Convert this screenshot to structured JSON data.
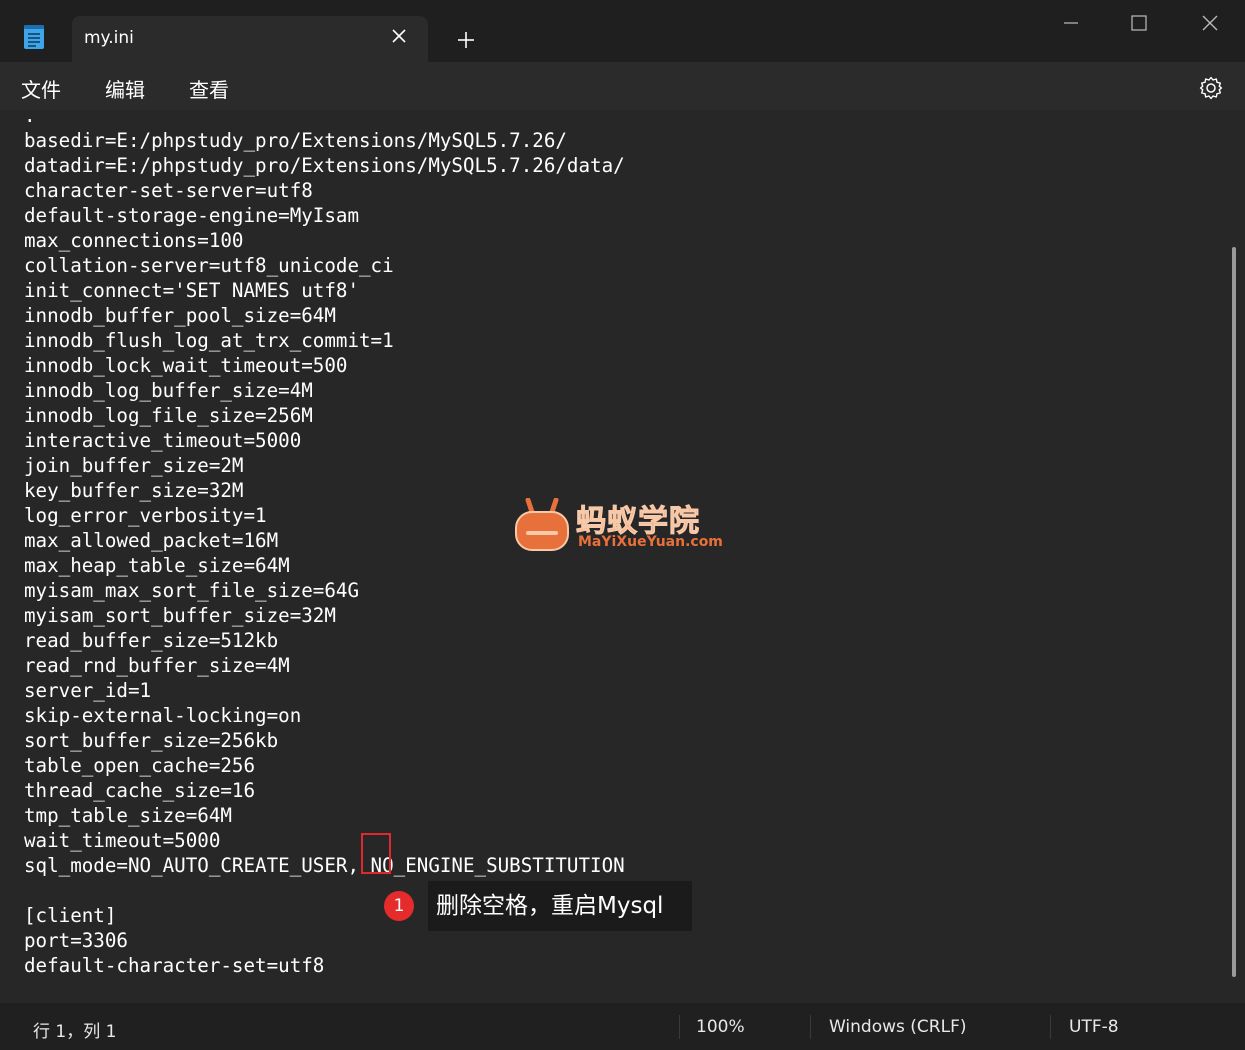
{
  "tab": {
    "title": "my.ini"
  },
  "menu": {
    "file": "文件",
    "edit": "编辑",
    "view": "查看"
  },
  "editor": {
    "lines": [
      ".",
      "basedir=E:/phpstudy_pro/Extensions/MySQL5.7.26/",
      "datadir=E:/phpstudy_pro/Extensions/MySQL5.7.26/data/",
      "character-set-server=utf8",
      "default-storage-engine=MyIsam",
      "max_connections=100",
      "collation-server=utf8_unicode_ci",
      "init_connect='SET NAMES utf8'",
      "innodb_buffer_pool_size=64M",
      "innodb_flush_log_at_trx_commit=1",
      "innodb_lock_wait_timeout=500",
      "innodb_log_buffer_size=4M",
      "innodb_log_file_size=256M",
      "interactive_timeout=5000",
      "join_buffer_size=2M",
      "key_buffer_size=32M",
      "log_error_verbosity=1",
      "max_allowed_packet=16M",
      "max_heap_table_size=64M",
      "myisam_max_sort_file_size=64G",
      "myisam_sort_buffer_size=32M",
      "read_buffer_size=512kb",
      "read_rnd_buffer_size=4M",
      "server_id=1",
      "skip-external-locking=on",
      "sort_buffer_size=256kb",
      "table_open_cache=256",
      "thread_cache_size=16",
      "tmp_table_size=64M",
      "wait_timeout=5000",
      "sql_mode=NO_AUTO_CREATE_USER, NO_ENGINE_SUBSTITUTION",
      "",
      "[client]",
      "port=3306",
      "default-character-set=utf8"
    ]
  },
  "annotation": {
    "badge": "1",
    "text": "删除空格，重启Mysql"
  },
  "watermark": {
    "cn": "蚂蚁学院",
    "en": "MaYiXueYuan.com"
  },
  "status": {
    "position": "行 1，列 1",
    "zoom": "100%",
    "line_ending": "Windows (CRLF)",
    "encoding": "UTF-8"
  },
  "colors": {
    "highlight": "#e0282e",
    "badge": "#e52b2b",
    "watermark": "#e8703a"
  }
}
